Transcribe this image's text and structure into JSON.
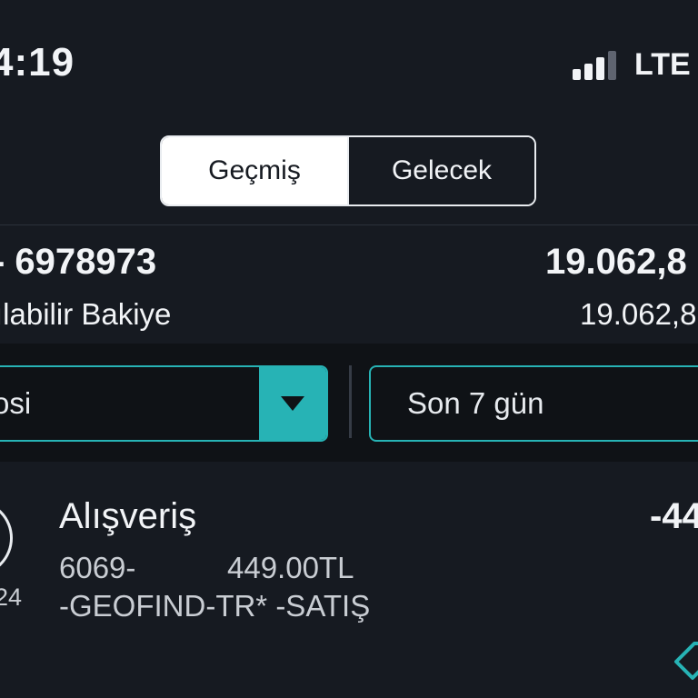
{
  "status_bar": {
    "time": "4:19",
    "network": "LTE",
    "signal_bars_filled": 3,
    "signal_bars_total": 4
  },
  "segment": {
    "tabs": [
      {
        "label": "Geçmiş",
        "active": true
      },
      {
        "label": "Gelecek",
        "active": false
      }
    ]
  },
  "account": {
    "number": "- 6978973",
    "balance": "19.062,8",
    "available_label": "ılabilir Bakiye",
    "available_balance": "19.062,8"
  },
  "filters": {
    "type_value": "osi",
    "period_value": "Son 7 gün"
  },
  "transactions": [
    {
      "date_year": "24",
      "title": "Alışveriş",
      "amount": "-44",
      "reference": "6069-",
      "price": "449.00TL",
      "merchant": "-GEOFIND-TR* -SATIŞ"
    }
  ],
  "colors": {
    "background": "#161a21",
    "accent": "#27b3b5",
    "filter_band": "#0f1216",
    "text_primary": "#f2f4f7",
    "text_secondary": "#c9cdd3"
  },
  "icons": {
    "dropdown": "triangle-down-icon",
    "tag": "price-tag-icon"
  }
}
